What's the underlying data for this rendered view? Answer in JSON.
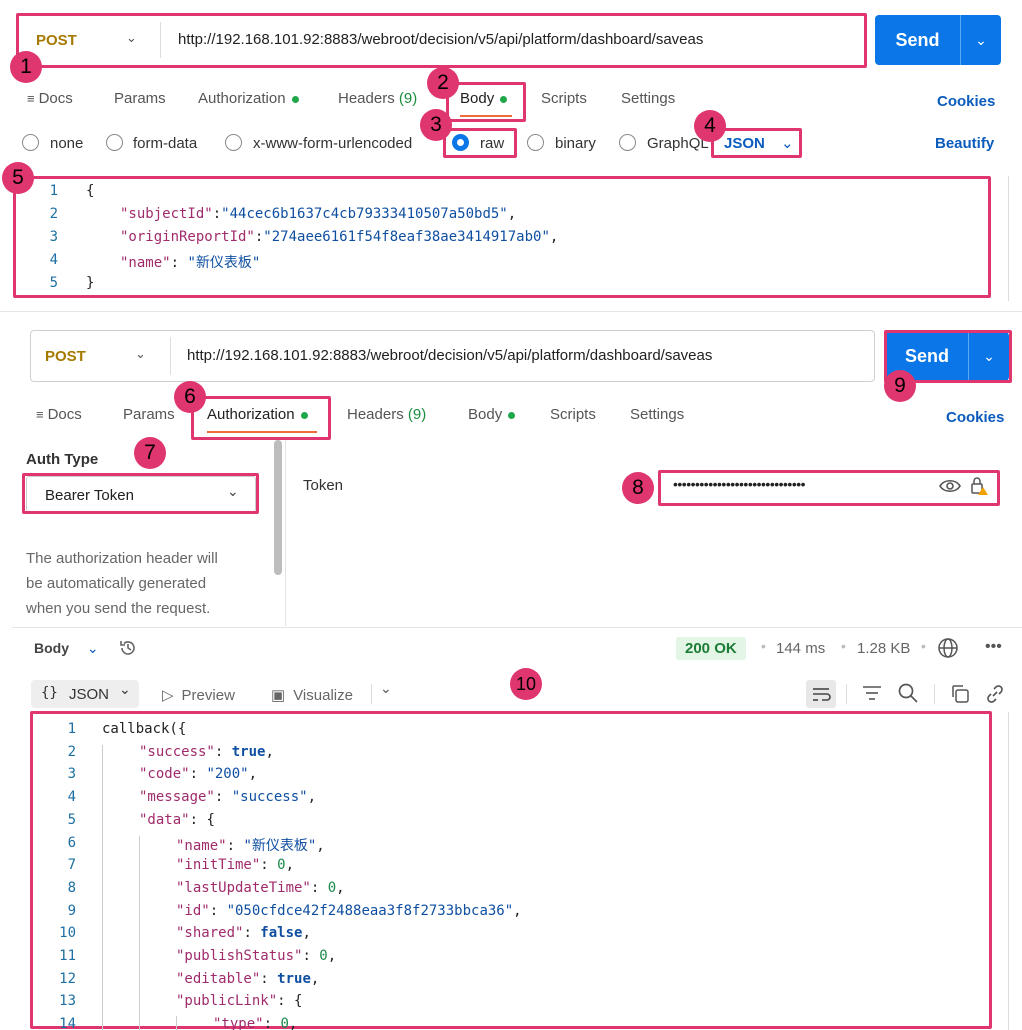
{
  "request1": {
    "method": "POST",
    "url": "http://192.168.101.92:8883/webroot/decision/v5/api/platform/dashboard/saveas",
    "send_label": "Send",
    "tabs": {
      "docs": "Docs",
      "params": "Params",
      "authorization": "Authorization",
      "headers": "Headers",
      "headers_count": "(9)",
      "body": "Body",
      "scripts": "Scripts",
      "settings": "Settings"
    },
    "cookies": "Cookies",
    "beautify": "Beautify",
    "body_types": [
      "none",
      "form-data",
      "x-www-form-urlencoded",
      "raw",
      "binary",
      "GraphQL"
    ],
    "selected_body_type": "raw",
    "format": "JSON",
    "body_lines": [
      {
        "n": "1",
        "text": "{"
      },
      {
        "n": "2",
        "key": "\"subjectId\"",
        "sep": ":",
        "val": "\"44cec6b1637c4cb79333410507a50bd5\"",
        "tail": ","
      },
      {
        "n": "3",
        "key": "\"originReportId\"",
        "sep": ":",
        "val": "\"274aee6161f54f8eaf38ae3414917ab0\"",
        "tail": ","
      },
      {
        "n": "4",
        "key": "\"name\"",
        "sep": ": ",
        "val": "\"新仪表板\"",
        "tail": ""
      },
      {
        "n": "5",
        "text": "}"
      }
    ]
  },
  "request2": {
    "method": "POST",
    "url": "http://192.168.101.92:8883/webroot/decision/v5/api/platform/dashboard/saveas",
    "send_label": "Send",
    "tabs": {
      "docs": "Docs",
      "params": "Params",
      "authorization": "Authorization",
      "headers": "Headers",
      "headers_count": "(9)",
      "body": "Body",
      "scripts": "Scripts",
      "settings": "Settings"
    },
    "cookies": "Cookies",
    "auth_type_label": "Auth Type",
    "auth_type_value": "Bearer Token",
    "auth_description": [
      "The authorization header will",
      "be automatically generated",
      "when you send the request."
    ],
    "token_label": "Token",
    "token_value": "••••••••••••••••••••••••••••••"
  },
  "response": {
    "body_label": "Body",
    "status": "200 OK",
    "time": "144 ms",
    "size": "1.28 KB",
    "format": "JSON",
    "preview": "Preview",
    "visualize": "Visualize",
    "lines": [
      {
        "n": "1",
        "indent": 0,
        "raw": "callback({"
      },
      {
        "n": "2",
        "indent": 1,
        "key": "\"success\"",
        "val": "true",
        "vt": "b",
        "tail": ","
      },
      {
        "n": "3",
        "indent": 1,
        "key": "\"code\"",
        "val": "\"200\"",
        "vt": "s",
        "tail": ","
      },
      {
        "n": "4",
        "indent": 1,
        "key": "\"message\"",
        "val": "\"success\"",
        "vt": "s",
        "tail": ","
      },
      {
        "n": "5",
        "indent": 1,
        "key": "\"data\"",
        "val": "{",
        "vt": "p",
        "tail": ""
      },
      {
        "n": "6",
        "indent": 2,
        "key": "\"name\"",
        "val": "\"新仪表板\"",
        "vt": "s",
        "tail": ","
      },
      {
        "n": "7",
        "indent": 2,
        "key": "\"initTime\"",
        "val": "0",
        "vt": "n",
        "tail": ","
      },
      {
        "n": "8",
        "indent": 2,
        "key": "\"lastUpdateTime\"",
        "val": "0",
        "vt": "n",
        "tail": ","
      },
      {
        "n": "9",
        "indent": 2,
        "key": "\"id\"",
        "val": "\"050cfdce42f2488eaa3f8f2733bbca36\"",
        "vt": "s",
        "tail": ","
      },
      {
        "n": "10",
        "indent": 2,
        "key": "\"shared\"",
        "val": "false",
        "vt": "b",
        "tail": ","
      },
      {
        "n": "11",
        "indent": 2,
        "key": "\"publishStatus\"",
        "val": "0",
        "vt": "n",
        "tail": ","
      },
      {
        "n": "12",
        "indent": 2,
        "key": "\"editable\"",
        "val": "true",
        "vt": "b",
        "tail": ","
      },
      {
        "n": "13",
        "indent": 2,
        "key": "\"publicLink\"",
        "val": "{",
        "vt": "p",
        "tail": ""
      },
      {
        "n": "14",
        "indent": 3,
        "key": "\"type\"",
        "val": "0",
        "vt": "n",
        "tail": ","
      }
    ]
  },
  "annotations": [
    "1",
    "2",
    "3",
    "4",
    "5",
    "6",
    "7",
    "8",
    "9",
    "10"
  ]
}
